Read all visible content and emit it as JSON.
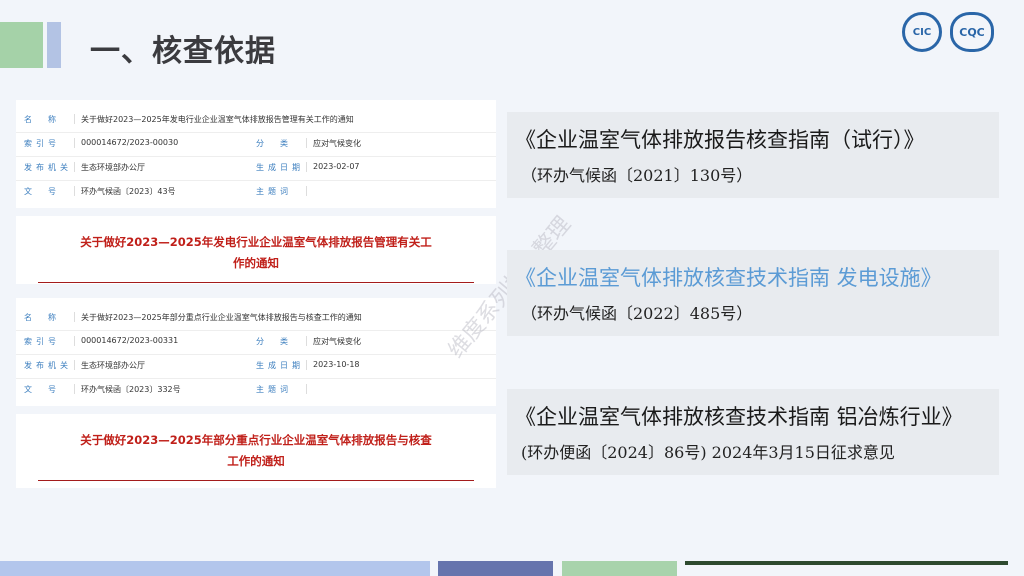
{
  "header": {
    "title": "一、核查依据",
    "logos": [
      "CIC",
      "CQC"
    ]
  },
  "labels": {
    "name": "名　称",
    "index": "索引号",
    "category": "分　类",
    "issuer": "发布机关",
    "date": "生成日期",
    "docno": "文　号",
    "keywords": "主题词"
  },
  "docs": [
    {
      "name": "关于做好2023—2025年发电行业企业温室气体排放报告管理有关工作的通知",
      "index": "000014672/2023-00030",
      "category": "应对气候变化",
      "issuer": "生态环境部办公厅",
      "date": "2023-02-07",
      "docno": "环办气候函〔2023〕43号",
      "keywords": "",
      "heading1": "关于做好2023—2025年发电行业企业温室气体排放报告管理有关工",
      "heading2": "作的通知"
    },
    {
      "name": "关于做好2023—2025年部分重点行业企业温室气体排放报告与核查工作的通知",
      "index": "000014672/2023-00331",
      "category": "应对气候变化",
      "issuer": "生态环境部办公厅",
      "date": "2023-10-18",
      "docno": "环办气候函〔2023〕332号",
      "keywords": "",
      "heading1": "关于做好2023—2025年部分重点行业企业温室气体排放报告与核查",
      "heading2": "工作的通知"
    }
  ],
  "guides": [
    {
      "title": "《企业温室气体排放报告核查指南（试行）》",
      "sub": "（环办气候函〔2021〕130号）",
      "color": "#1a1a1a"
    },
    {
      "title": "《企业温室气体排放核查技术指南 发电设施》",
      "sub": "（环办气候函〔2022〕485号）",
      "color": "#5b9bd5"
    },
    {
      "title": "《企业温室气体排放核查技术指南 铝冶炼行业》",
      "sub": "(环办便函〔2024〕86号) 2024年3月15日征求意见",
      "color": "#1a1a1a"
    }
  ],
  "watermark": "维度系列报告整理"
}
